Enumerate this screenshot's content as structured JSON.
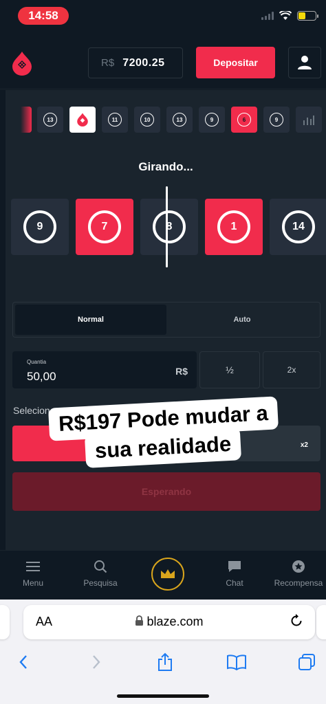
{
  "status_bar": {
    "time": "14:58"
  },
  "header": {
    "balance_currency": "R$",
    "balance_amount": "7200.25",
    "deposit_label": "Depositar"
  },
  "history": [
    {
      "color": "red",
      "number": ""
    },
    {
      "color": "dark",
      "number": "13"
    },
    {
      "color": "white",
      "number": ""
    },
    {
      "color": "dark",
      "number": "11"
    },
    {
      "color": "dark",
      "number": "10"
    },
    {
      "color": "dark",
      "number": "13"
    },
    {
      "color": "dark",
      "number": "9"
    },
    {
      "color": "red",
      "number": "6"
    },
    {
      "color": "dark",
      "number": "9"
    }
  ],
  "roll": {
    "status": "Girando...",
    "tiles": [
      {
        "color": "dark",
        "number": "9"
      },
      {
        "color": "red",
        "number": "7"
      },
      {
        "color": "dark",
        "number": "8"
      },
      {
        "color": "red",
        "number": "1"
      },
      {
        "color": "dark",
        "number": "14"
      }
    ]
  },
  "bet": {
    "mode_normal": "Normal",
    "mode_auto": "Auto",
    "amount_label": "Quantia",
    "amount_value": "50,00",
    "amount_currency": "R$",
    "half_label": "½",
    "double_label": "2x",
    "select_color_label": "Selecionar Cor",
    "black_multiplier": "x2",
    "waiting_label": "Esperando"
  },
  "caption": {
    "line1": "R$197 Pode mudar a",
    "line2": "sua realidade"
  },
  "bottom_nav": [
    {
      "label": "Menu",
      "icon": "menu-icon"
    },
    {
      "label": "Pesquisa",
      "icon": "search-icon"
    },
    {
      "label": "Chat",
      "icon": "chat-icon"
    },
    {
      "label": "Recompensa",
      "icon": "star-icon"
    }
  ],
  "browser": {
    "aa_label": "AA",
    "url": "blaze.com"
  },
  "colors": {
    "red": "#f12c4c",
    "dark": "#262f3c",
    "background": "#0f1923",
    "gold": "#d9a51c"
  }
}
